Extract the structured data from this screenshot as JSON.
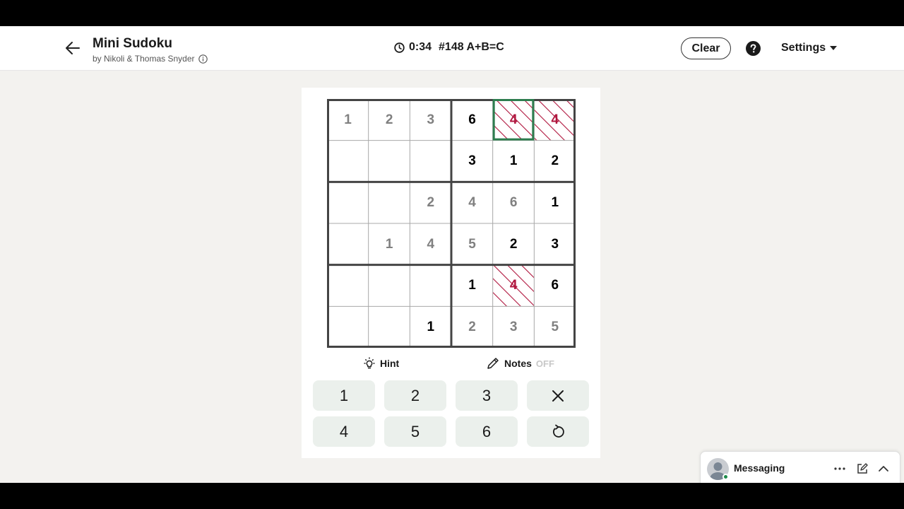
{
  "header": {
    "title": "Mini Sudoku",
    "byline": "by Nikoli & Thomas Snyder",
    "timer": "0:34",
    "puzzle_label": "#148 A+B=C",
    "clear_label": "Clear",
    "settings_label": "Settings"
  },
  "grid": {
    "size": 6,
    "selected": [
      0,
      4
    ],
    "rows": [
      [
        {
          "v": "1",
          "s": "filled"
        },
        {
          "v": "2",
          "s": "filled"
        },
        {
          "v": "3",
          "s": "filled"
        },
        {
          "v": "6",
          "s": "given"
        },
        {
          "v": "4",
          "s": "conflict"
        },
        {
          "v": "4",
          "s": "conflict"
        }
      ],
      [
        {
          "v": "",
          "s": "empty"
        },
        {
          "v": "",
          "s": "empty"
        },
        {
          "v": "",
          "s": "empty"
        },
        {
          "v": "3",
          "s": "given"
        },
        {
          "v": "1",
          "s": "given"
        },
        {
          "v": "2",
          "s": "given"
        }
      ],
      [
        {
          "v": "",
          "s": "empty"
        },
        {
          "v": "",
          "s": "empty"
        },
        {
          "v": "2",
          "s": "filled"
        },
        {
          "v": "4",
          "s": "filled"
        },
        {
          "v": "6",
          "s": "filled"
        },
        {
          "v": "1",
          "s": "given"
        }
      ],
      [
        {
          "v": "",
          "s": "empty"
        },
        {
          "v": "1",
          "s": "filled"
        },
        {
          "v": "4",
          "s": "filled"
        },
        {
          "v": "5",
          "s": "filled"
        },
        {
          "v": "2",
          "s": "given"
        },
        {
          "v": "3",
          "s": "given"
        }
      ],
      [
        {
          "v": "",
          "s": "empty"
        },
        {
          "v": "",
          "s": "empty"
        },
        {
          "v": "",
          "s": "empty"
        },
        {
          "v": "1",
          "s": "given"
        },
        {
          "v": "4",
          "s": "conflict"
        },
        {
          "v": "6",
          "s": "given"
        }
      ],
      [
        {
          "v": "",
          "s": "empty"
        },
        {
          "v": "",
          "s": "empty"
        },
        {
          "v": "1",
          "s": "given"
        },
        {
          "v": "2",
          "s": "filled"
        },
        {
          "v": "3",
          "s": "filled"
        },
        {
          "v": "5",
          "s": "filled"
        }
      ]
    ]
  },
  "tools": {
    "hint_label": "Hint",
    "notes_label": "Notes",
    "notes_state": "OFF"
  },
  "keypad": [
    {
      "label": "1",
      "name": "key-1"
    },
    {
      "label": "2",
      "name": "key-2"
    },
    {
      "label": "3",
      "name": "key-3"
    },
    {
      "label": "",
      "name": "erase-button",
      "icon": "close-icon"
    },
    {
      "label": "4",
      "name": "key-4"
    },
    {
      "label": "5",
      "name": "key-5"
    },
    {
      "label": "6",
      "name": "key-6"
    },
    {
      "label": "",
      "name": "undo-button",
      "icon": "undo-icon"
    }
  ],
  "messaging": {
    "label": "Messaging"
  },
  "colors": {
    "conflict": "#b0163e",
    "selected_border": "#2e7d4f",
    "key_bg": "#ebf0ec",
    "given_text": "#000000",
    "filled_text": "#808080"
  }
}
